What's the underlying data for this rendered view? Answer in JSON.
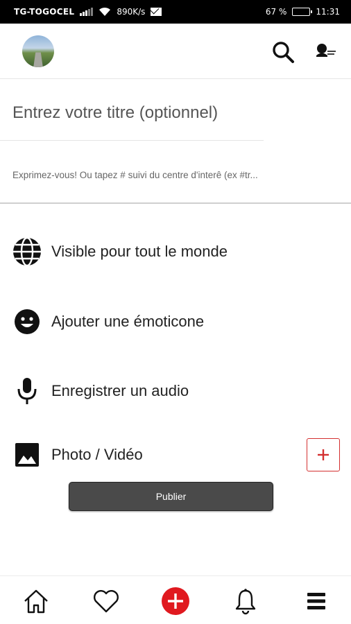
{
  "status_bar": {
    "carrier": "TG-TOGOCEL",
    "speed": "890K/s",
    "battery": "67 %",
    "battery_level": 0.67,
    "time": "11:31"
  },
  "header": {
    "avatar_icon": "avatar",
    "search_icon": "search-icon",
    "profile_icon": "profile-icon"
  },
  "compose": {
    "title_placeholder": "Entrez votre titre (optionnel)",
    "body_placeholder": "Exprimez-vous! Ou tapez # suivi du centre d'interê (ex #tr..."
  },
  "options": [
    {
      "label": "Visible pour tout le monde",
      "icon": "globe-icon"
    },
    {
      "label": "Ajouter une émoticone",
      "icon": "emoji-icon"
    },
    {
      "label": "Enregistrer un audio",
      "icon": "microphone-icon"
    },
    {
      "label": "Photo / Vidéo",
      "icon": "image-icon"
    }
  ],
  "publish_label": "Publier",
  "add_media_icon": "plus-icon",
  "colors": {
    "accent": "#d32f2f",
    "publish_bg": "#4a4a4a",
    "center_nav": "#e0191f"
  },
  "bottom_nav": [
    "home-icon",
    "heart-icon",
    "add-icon",
    "bell-icon",
    "menu-icon"
  ]
}
